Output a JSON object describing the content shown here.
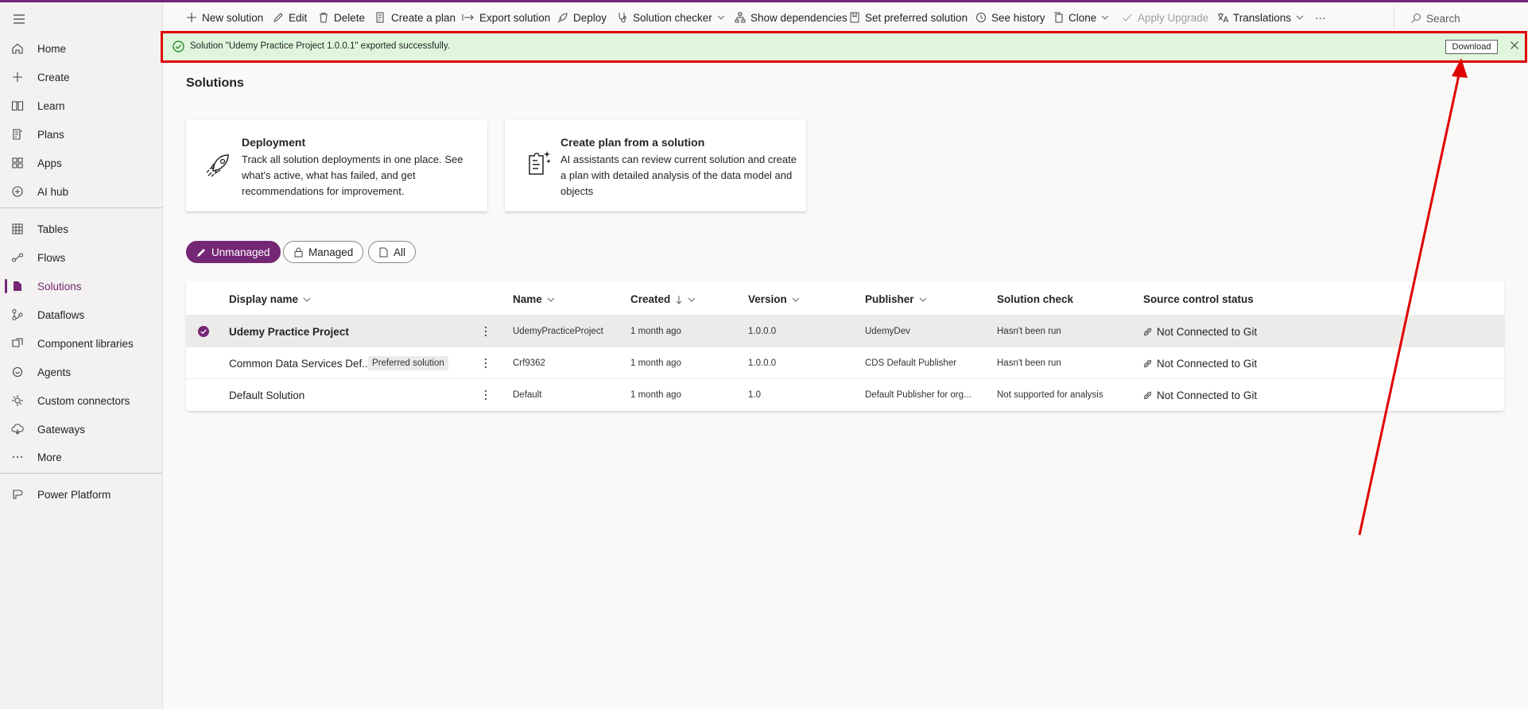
{
  "sidebar": {
    "items": [
      {
        "label": "Home",
        "icon": "home-icon"
      },
      {
        "label": "Create",
        "icon": "plus-icon"
      },
      {
        "label": "Learn",
        "icon": "book-icon"
      },
      {
        "label": "Plans",
        "icon": "plans-icon"
      },
      {
        "label": "Apps",
        "icon": "apps-icon"
      },
      {
        "label": "AI hub",
        "icon": "ai-hub-icon"
      },
      {
        "label": "Tables",
        "icon": "table-icon"
      },
      {
        "label": "Flows",
        "icon": "flow-icon"
      },
      {
        "label": "Solutions",
        "icon": "solutions-icon"
      },
      {
        "label": "Dataflows",
        "icon": "dataflow-icon"
      },
      {
        "label": "Component libraries",
        "icon": "component-library-icon"
      },
      {
        "label": "Agents",
        "icon": "agent-icon"
      },
      {
        "label": "Custom connectors",
        "icon": "connector-icon"
      },
      {
        "label": "Gateways",
        "icon": "gateway-icon"
      },
      {
        "label": "More",
        "icon": "more-icon"
      },
      {
        "label": "Power Platform",
        "icon": "power-platform-icon"
      }
    ],
    "active": "Solutions"
  },
  "toolbar": {
    "new_solution": "New solution",
    "edit": "Edit",
    "delete": "Delete",
    "create_plan": "Create a plan",
    "export_solution": "Export solution",
    "deploy": "Deploy",
    "solution_checker": "Solution checker",
    "show_dependencies": "Show dependencies",
    "set_preferred": "Set preferred solution",
    "see_history": "See history",
    "clone": "Clone",
    "apply_upgrade": "Apply Upgrade",
    "translations": "Translations",
    "more": "···",
    "search_placeholder": "Search"
  },
  "banner": {
    "message": "Solution \"Udemy Practice Project 1.0.0.1\" exported successfully.",
    "download_label": "Download"
  },
  "main": {
    "title": "Solutions",
    "cards": [
      {
        "title": "Deployment",
        "desc_lines": [
          "Track all solution deployments in one place. See",
          "what's active, what has failed, and get",
          "recommendations for improvement."
        ]
      },
      {
        "title": "Create plan from a solution",
        "desc_lines": [
          "AI assistants can review current solution and create",
          "a plan with detailed analysis of the data model and",
          "objects"
        ]
      }
    ],
    "filters": [
      "Unmanaged",
      "Managed",
      "All"
    ],
    "active_filter": "Unmanaged"
  },
  "table": {
    "columns": [
      "Display name",
      "Name",
      "Created",
      "Version",
      "Publisher",
      "Solution check",
      "Source control status"
    ],
    "rows": [
      {
        "display_name": "Udemy Practice Project",
        "badge": "",
        "name": "UdemyPracticeProject",
        "created": "1 month ago",
        "version": "1.0.0.0",
        "publisher": "UdemyDev",
        "solution_check": "Hasn't been run",
        "source_control": "Not Connected to Git",
        "selected": true
      },
      {
        "display_name": "Common Data Services Def...",
        "badge": "Preferred solution",
        "name": "Crf9362",
        "created": "1 month ago",
        "version": "1.0.0.0",
        "publisher": "CDS Default Publisher",
        "solution_check": "Hasn't been run",
        "source_control": "Not Connected to Git",
        "selected": false
      },
      {
        "display_name": "Default Solution",
        "badge": "",
        "name": "Default",
        "created": "1 month ago",
        "version": "1.0",
        "publisher": "Default Publisher for org...",
        "solution_check": "Not supported for analysis",
        "source_control": "Not Connected to Git",
        "selected": false
      }
    ]
  },
  "colors": {
    "accent": "#742774",
    "banner_bg": "#dff6dd",
    "success": "#107c10",
    "annotation": "#e00000"
  }
}
